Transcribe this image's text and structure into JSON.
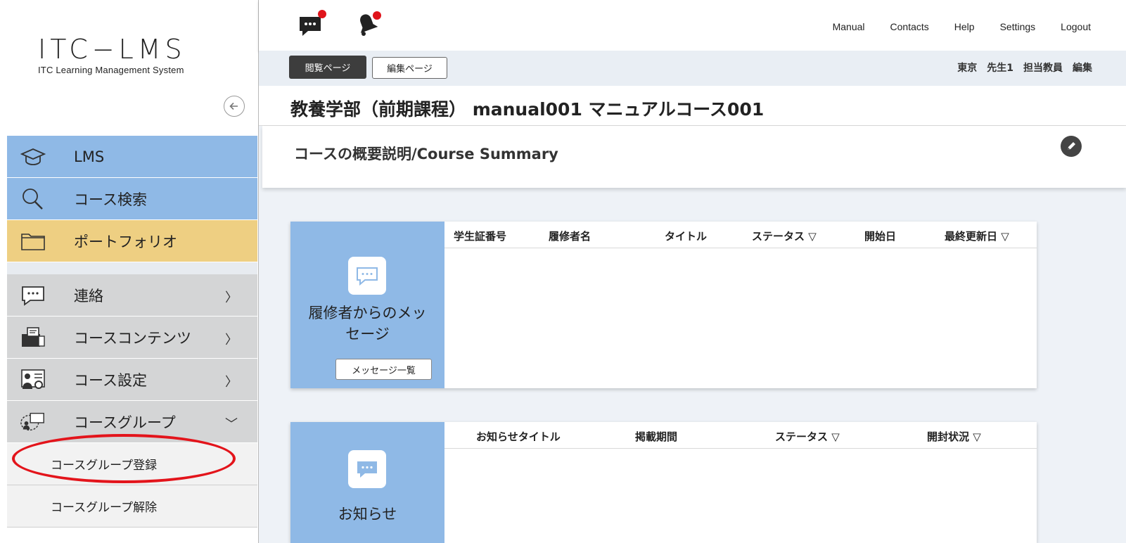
{
  "sidebar": {
    "logo": {
      "main": "ITC−LMS",
      "sub": "ITC Learning Management System"
    },
    "menu": [
      {
        "label": "LMS",
        "icon": "graduation-cap-icon"
      },
      {
        "label": "コース検索",
        "icon": "magnifier-icon"
      },
      {
        "label": "ポートフォリオ",
        "icon": "folder-icon"
      },
      {
        "label": "連絡",
        "icon": "message-icon",
        "chevron": "〉"
      },
      {
        "label": "コースコンテンツ",
        "icon": "course-contents-icon",
        "chevron": "〉"
      },
      {
        "label": "コース設定",
        "icon": "course-settings-icon",
        "chevron": "〉"
      },
      {
        "label": "コースグループ",
        "icon": "course-group-icon",
        "chevron": "﹀"
      }
    ],
    "submenu": [
      {
        "label": "コースグループ登録"
      },
      {
        "label": "コースグループ解除"
      }
    ]
  },
  "header": {
    "links": [
      "Manual",
      "Contacts",
      "Help",
      "Settings",
      "Logout"
    ]
  },
  "toolbar": {
    "view_label": "閲覧ページ",
    "edit_label": "編集ページ",
    "user": {
      "campus": "東京",
      "name": "先生1",
      "role": "担当教員",
      "edit": "編集"
    }
  },
  "course": {
    "title": "教養学部（前期課程） manual001 マニュアルコース001",
    "summary_title": "コースの概要説明/Course Summary"
  },
  "panels": {
    "messages": {
      "label_line1": "履修者からのメッ",
      "label_line2": "セージ",
      "button": "メッセージ一覧",
      "columns": [
        "学生証番号",
        "履修者名",
        "タイトル",
        "ステータス ▽",
        "開始日",
        "最終更新日 ▽"
      ]
    },
    "notices": {
      "label": "お知らせ",
      "columns": [
        "お知らせタイトル",
        "掲載期間",
        "ステータス ▽",
        "開封状況 ▽"
      ]
    }
  },
  "colors": {
    "accent_blue": "#8fb9e6",
    "portfolio_yellow": "#eecf82",
    "badge_red": "#e0141b",
    "highlight_red": "#e3141b"
  }
}
